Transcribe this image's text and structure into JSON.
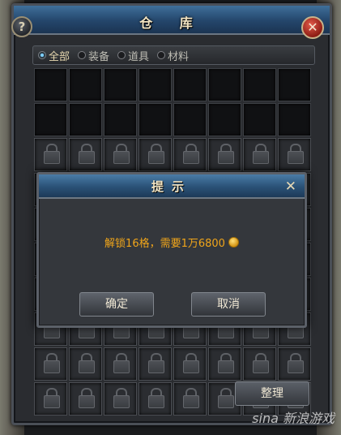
{
  "window": {
    "title": "仓 库"
  },
  "tabs": [
    {
      "label": "全部",
      "active": true
    },
    {
      "label": "装备",
      "active": false
    },
    {
      "label": "道具",
      "active": false
    },
    {
      "label": "材料",
      "active": false
    }
  ],
  "buttons": {
    "sort": "整理"
  },
  "dialog": {
    "title": "提示",
    "message": "解锁16格，需要1万6800",
    "confirm": "确定",
    "cancel": "取消",
    "close_glyph": "✕"
  },
  "watermark": "sina 新浪游戏",
  "colors": {
    "accent": "#f0a51a",
    "title_bar": "#2a5176"
  }
}
